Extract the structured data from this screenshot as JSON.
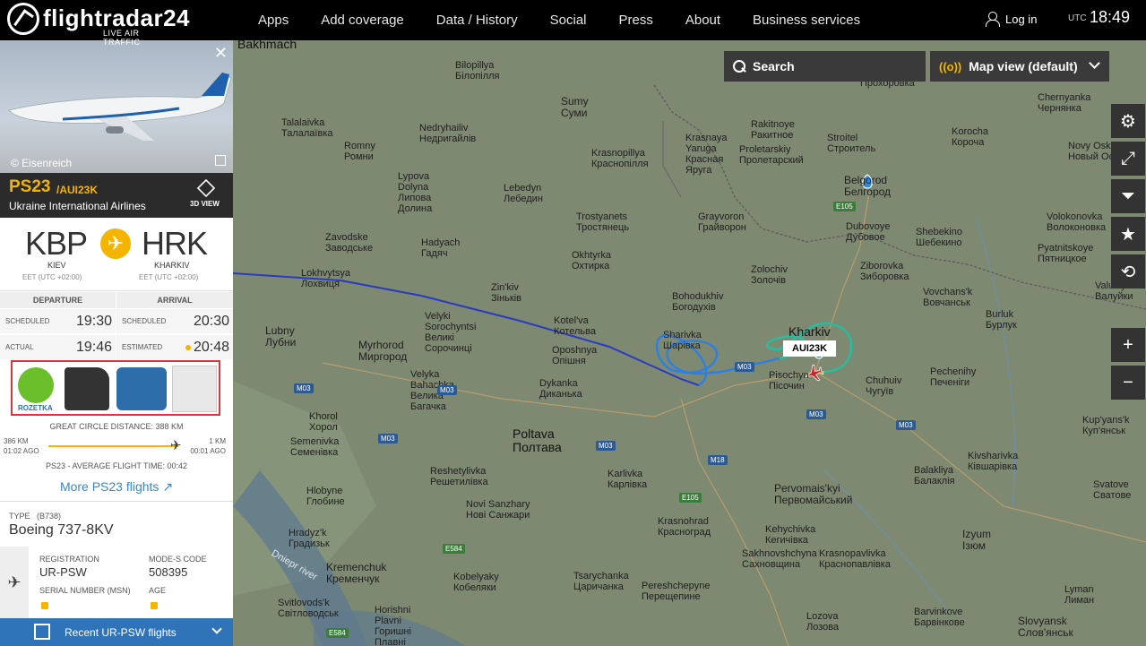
{
  "brand": {
    "name": "flightradar24",
    "tagline": "LIVE AIR TRAFFIC"
  },
  "nav": {
    "items": [
      "Apps",
      "Add coverage",
      "Data / History",
      "Social",
      "Press",
      "About",
      "Business services"
    ],
    "login": "Log in",
    "utc_label": "UTC",
    "time": "18:49"
  },
  "map_controls": {
    "search": "Search",
    "map_view": "Map view (default)"
  },
  "tools": [
    "gear-icon",
    "fullscreen-icon",
    "filter-icon",
    "star-icon",
    "playback-icon",
    "zoom-in-icon",
    "zoom-out-icon"
  ],
  "tool_glyphs": {
    "zoom_in": "+",
    "zoom_out": "−"
  },
  "map": {
    "callsign_label": "AUI23K",
    "places": [
      {
        "t": "Bakhmach",
        "c": "big"
      },
      {
        "t": "Bilopillya\nБілопілля"
      },
      {
        "t": "Sumy\nСуми",
        "c": "mid"
      },
      {
        "t": "Talalaivka\nТалалаївка"
      },
      {
        "t": "Romny\nРомни"
      },
      {
        "t": "Nedryhailiv\nНедригайлів"
      },
      {
        "t": "Krasnopillya\nКраснопілля"
      },
      {
        "t": "Krasnaya\nYaruga\nКрасная\nЯруга"
      },
      {
        "t": "Rakitnoye\nРакитное"
      },
      {
        "t": "Proletarskiy\nПролетарский"
      },
      {
        "t": "Stroitel\nСтроитель"
      },
      {
        "t": "Prokhorovka\nПрохоровка"
      },
      {
        "t": "Korocha\nКороча"
      },
      {
        "t": "Chernyanka\nЧернянка"
      },
      {
        "t": "Novy Oskol\nНовый Оскол"
      },
      {
        "t": "Belgorod\nБелгород",
        "c": "mid"
      },
      {
        "t": "Lypova\nDolyna\nЛипова\nДолина"
      },
      {
        "t": "Lebedyn\nЛебедин"
      },
      {
        "t": "Trostyanets\nТростянець"
      },
      {
        "t": "Grayvoron\nГрайворон"
      },
      {
        "t": "Dubovoye\nДубовое"
      },
      {
        "t": "Shebekino\nШебекино"
      },
      {
        "t": "Volokonovka\nВолоконовка"
      },
      {
        "t": "Zavodske\nЗаводське"
      },
      {
        "t": "Hadyach\nГадяч"
      },
      {
        "t": "Okhtyrka\nОхтирка"
      },
      {
        "t": "Zolochiv\nЗолочів"
      },
      {
        "t": "Ziborovka\nЗиборовка"
      },
      {
        "t": "Pyatnitskoye\nПятницкое"
      },
      {
        "t": "Lokhvytsya\nЛохвиця"
      },
      {
        "t": "Zin'kiv\nЗіньків"
      },
      {
        "t": "Bohodukhiv\nБогодухів"
      },
      {
        "t": "Vovchans'k\nВовчанськ"
      },
      {
        "t": "Valuiky\nВалуйки"
      },
      {
        "t": "Velyki\nSorochyntsi\nВеликі\nСорочинці"
      },
      {
        "t": "Kotel'va\nКотельва"
      },
      {
        "t": "Sharivka\nШарівка"
      },
      {
        "t": "Kharkiv",
        "c": "big"
      },
      {
        "t": "Burluk\nБурлук"
      },
      {
        "t": "Lubny\nЛубни",
        "c": "mid"
      },
      {
        "t": "Myrhorod\nМиргород",
        "c": "mid"
      },
      {
        "t": "Oposhnya\nОпішня"
      },
      {
        "t": "Pisochyn\nПісочин"
      },
      {
        "t": "Chuhuiv\nЧугуїв"
      },
      {
        "t": "Pechenihy\nПеченіги"
      },
      {
        "t": "Velyka\nBahachka\nВелика\nБагачка"
      },
      {
        "t": "Dykanka\nДиканька"
      },
      {
        "t": "Khorol\nХорол"
      },
      {
        "t": "Poltava\nПолтава",
        "c": "big"
      },
      {
        "t": "Kup'yans'k\nКуп'янськ"
      },
      {
        "t": "Semenivka\nСеменівка"
      },
      {
        "t": "Reshetylivka\nРешетилівка"
      },
      {
        "t": "Karlivka\nКарлівка"
      },
      {
        "t": "Balakliya\nБалаклія"
      },
      {
        "t": "Kivsharivka\nКівшарівка"
      },
      {
        "t": "Hlobyne\nГлобине"
      },
      {
        "t": "Novi Sanzhary\nНові Санжари"
      },
      {
        "t": "Pervomais'kyi\nПервомайський",
        "c": "mid"
      },
      {
        "t": "Svatove\nСватове"
      },
      {
        "t": "Krasnohrad\nКрасноград"
      },
      {
        "t": "Kehychivka\nКегичівка"
      },
      {
        "t": "Hradyz'k\nГрадизьк"
      },
      {
        "t": "Sakhnovshchyna\nСахновщина"
      },
      {
        "t": "Krasnopavlivka\nКраснопавлівка"
      },
      {
        "t": "Izyum\nІзюм",
        "c": "mid"
      },
      {
        "t": "Kremenchuk\nКременчук",
        "c": "mid"
      },
      {
        "t": "Kobelyaky\nКобеляки"
      },
      {
        "t": "Tsarychanka\nЦаричанка"
      },
      {
        "t": "Pereshchepyne\nПерещепине"
      },
      {
        "t": "Lyman\nЛиман"
      },
      {
        "t": "Svitlovods'k\nСвітловодськ"
      },
      {
        "t": "Lozova\nЛозова"
      },
      {
        "t": "Barvinkove\nБарвінкове"
      },
      {
        "t": "Slovyansk\nСлов'янськ",
        "c": "mid"
      },
      {
        "t": "Horishni\nPlavni\nГоришні\nПлавні"
      },
      {
        "t": "Dniepr river"
      }
    ],
    "roads": [
      "M03",
      "M03",
      "M03",
      "M03",
      "M03",
      "M03",
      "M03",
      "M18",
      "E105",
      "E105",
      "E584",
      "E584"
    ]
  },
  "flight": {
    "photo_credit": "© Eisenreich",
    "number": "PS23",
    "callsign": "/AUI23K",
    "airline": "Ukraine International Airlines",
    "view3d": "3D VIEW",
    "origin": {
      "code": "KBP",
      "city": "KIEV",
      "tz": "EET (UTC +02:00)"
    },
    "destination": {
      "code": "HRK",
      "city": "KHARKIV",
      "tz": "EET (UTC +02:00)"
    },
    "departure_label": "DEPARTURE",
    "arrival_label": "ARRIVAL",
    "sched_dep_label": "SCHEDULED",
    "sched_dep": "19:30",
    "sched_arr_label": "SCHEDULED",
    "sched_arr": "20:30",
    "actual_dep_label": "ACTUAL",
    "actual_dep": "19:46",
    "est_arr_label": "ESTIMATED",
    "est_arr": "20:48",
    "ad_label": "ROZETKA",
    "distance": "GREAT CIRCLE DISTANCE: 388 KM",
    "flown_km": "386 KM",
    "flown_ago": "01:02 AGO",
    "remain_km": "1 KM",
    "remain_ago": "00:01 AGO",
    "progress": 0.99,
    "avg_time": "PS23 - AVERAGE FLIGHT TIME: 00:42",
    "more_link": "More PS23 flights",
    "type_label": "TYPE",
    "type_code": "(B738)",
    "aircraft": "Boeing 737-8KV",
    "registration_label": "REGISTRATION",
    "registration": "UR-PSW",
    "modes_label": "MODE-S CODE",
    "modes": "508395",
    "serial_label": "SERIAL NUMBER (MSN)",
    "age_label": "AGE",
    "recent": "Recent UR-PSW flights"
  }
}
